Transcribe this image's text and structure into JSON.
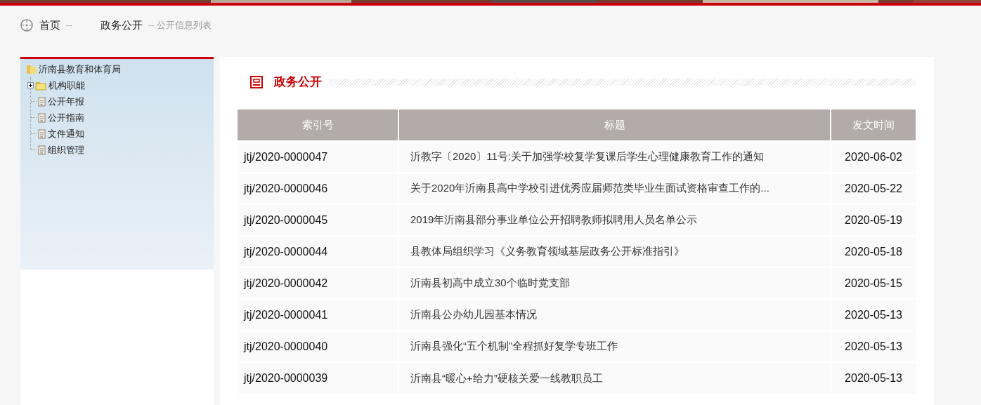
{
  "breadcrumb": {
    "items": [
      {
        "label": "首页",
        "separator": "--"
      },
      {
        "label": "政务公开",
        "separator": "--"
      }
    ],
    "current": "公开信息列表"
  },
  "tree": {
    "root": {
      "label": "沂南县教育和体育局",
      "children": [
        {
          "label": "机构职能",
          "kind": "folder",
          "expanded": false
        },
        {
          "label": "公开年报",
          "kind": "document"
        },
        {
          "label": "公开指南",
          "kind": "document"
        },
        {
          "label": "文件通知",
          "kind": "document"
        },
        {
          "label": "组织管理",
          "kind": "document"
        }
      ]
    }
  },
  "section": {
    "title": "政务公开"
  },
  "table": {
    "columns": [
      "索引号",
      "标题",
      "发文时间"
    ],
    "rows": [
      [
        "jtj/2020-0000047",
        "沂教字〔2020〕11号:关于加强学校复学复课后学生心理健康教育工作的通知",
        "2020-06-02"
      ],
      [
        "jtj/2020-0000046",
        "关于2020年沂南县高中学校引进优秀应届师范类毕业生面试资格审查工作的...",
        "2020-05-22"
      ],
      [
        "jtj/2020-0000045",
        "2019年沂南县部分事业单位公开招聘教师拟聘用人员名单公示",
        "2020-05-19"
      ],
      [
        "jtj/2020-0000044",
        "县教体局组织学习《义务教育领域基层政务公开标准指引》",
        "2020-05-18"
      ],
      [
        "jtj/2020-0000042",
        "沂南县初高中成立30个临时党支部",
        "2020-05-15"
      ],
      [
        "jtj/2020-0000041",
        "沂南县公办幼儿园基本情况",
        "2020-05-13"
      ],
      [
        "jtj/2020-0000040",
        "沂南县强化“五个机制”全程抓好复学专班工作",
        "2020-05-13"
      ],
      [
        "jtj/2020-0000039",
        "沂南县“暖心+给力”硬核关爱一线教职员工",
        "2020-05-13"
      ]
    ]
  }
}
